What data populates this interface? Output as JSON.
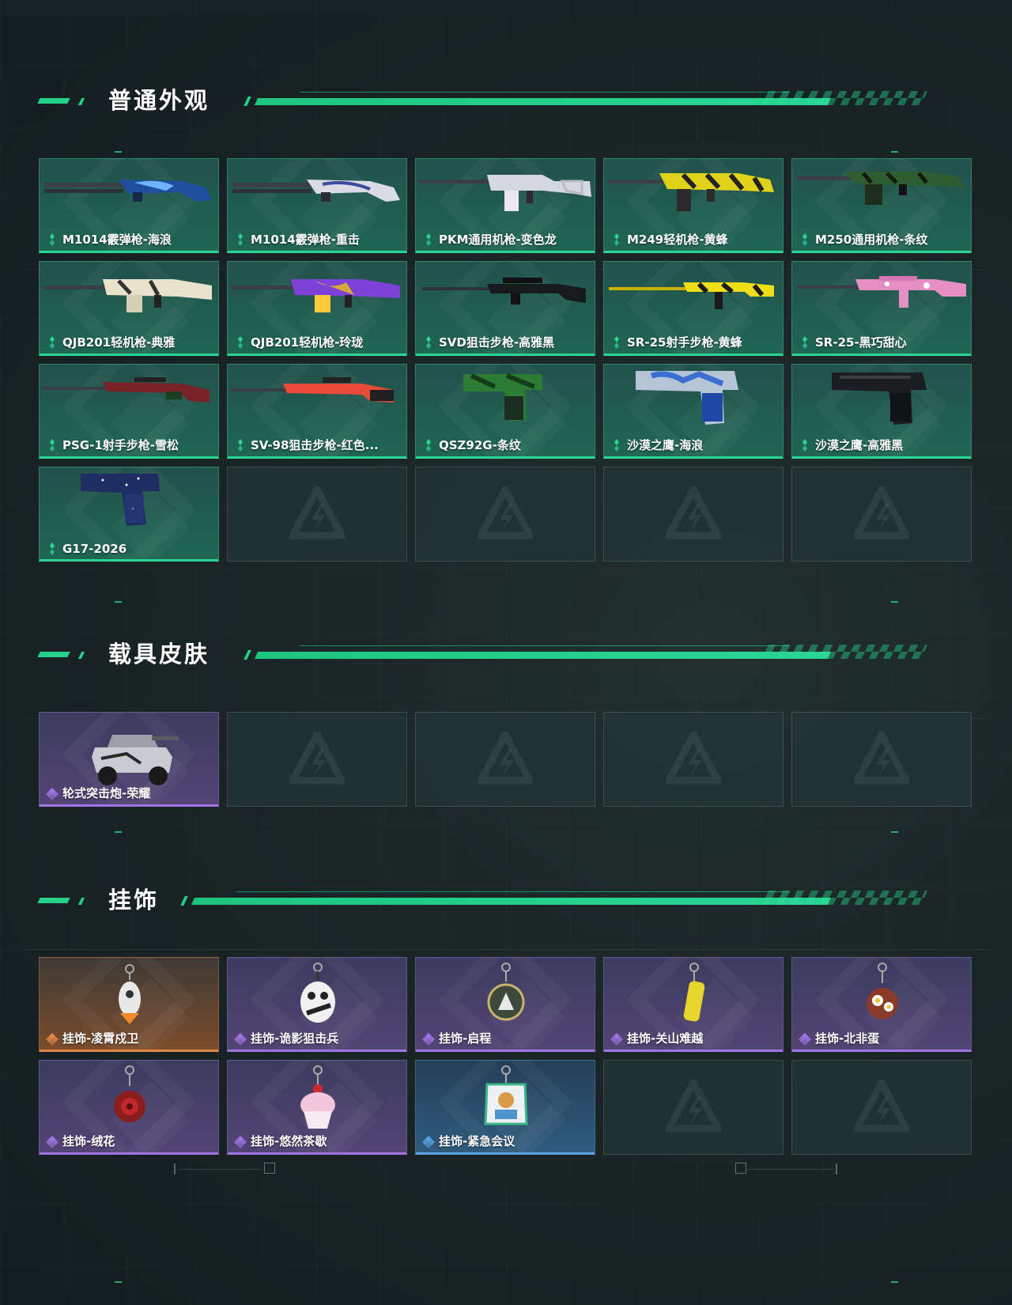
{
  "sections": [
    {
      "title": "普通外观",
      "items": [
        {
          "name": "M1014霰弹枪-海浪",
          "rarity": "green",
          "art": "shotgun-blue"
        },
        {
          "name": "M1014霰弹枪-重击",
          "rarity": "green",
          "art": "shotgun-white"
        },
        {
          "name": "PKM通用机枪-变色龙",
          "rarity": "green",
          "art": "mg-white"
        },
        {
          "name": "M249轻机枪-黄蜂",
          "rarity": "green",
          "art": "mg-yellow"
        },
        {
          "name": "M250通用机枪-条纹",
          "rarity": "green",
          "art": "mg-green"
        },
        {
          "name": "QJB201轻机枪-典雅",
          "rarity": "green",
          "art": "mg-cream"
        },
        {
          "name": "QJB201轻机枪-玲珑",
          "rarity": "green",
          "art": "mg-purple"
        },
        {
          "name": "SVD狙击步枪-高雅黑",
          "rarity": "green",
          "art": "sniper-black"
        },
        {
          "name": "SR-25射手步枪-黄蜂",
          "rarity": "green",
          "art": "rifle-yellow"
        },
        {
          "name": "SR-25-黑巧甜心",
          "rarity": "green",
          "art": "rifle-pink"
        },
        {
          "name": "PSG-1射手步枪-雪松",
          "rarity": "green",
          "art": "sniper-red"
        },
        {
          "name": "SV-98狙击步枪-红色...",
          "rarity": "green",
          "art": "sniper-orange"
        },
        {
          "name": "QSZ92G-条纹",
          "rarity": "green",
          "art": "pistol-green"
        },
        {
          "name": "沙漠之鹰-海浪",
          "rarity": "green",
          "art": "deagle-blue"
        },
        {
          "name": "沙漠之鹰-高雅黑",
          "rarity": "green",
          "art": "deagle-black"
        },
        {
          "name": "G17-2026",
          "rarity": "green",
          "art": "pistol-navy"
        }
      ],
      "empty_slots": 4
    },
    {
      "title": "载具皮肤",
      "items": [
        {
          "name": "轮式突击炮-荣耀",
          "rarity": "purple",
          "art": "vehicle"
        }
      ],
      "empty_slots": 4
    },
    {
      "title": "挂饰",
      "items": [
        {
          "name": "挂饰-凌霄戍卫",
          "rarity": "orange",
          "art": "charm-rocket"
        },
        {
          "name": "挂饰-诡影狙击兵",
          "rarity": "purple",
          "art": "charm-duck"
        },
        {
          "name": "挂饰-启程",
          "rarity": "purple",
          "art": "charm-medal"
        },
        {
          "name": "挂饰-关山难越",
          "rarity": "purple",
          "art": "charm-cylinder"
        },
        {
          "name": "挂饰-北非蛋",
          "rarity": "purple",
          "art": "charm-egg"
        },
        {
          "name": "挂饰-绒花",
          "rarity": "purple",
          "art": "charm-flower"
        },
        {
          "name": "挂饰-悠然茶歇",
          "rarity": "purple",
          "art": "charm-cupcake"
        },
        {
          "name": "挂饰-紧急会议",
          "rarity": "blue",
          "art": "charm-badge"
        }
      ],
      "empty_slots": 2
    }
  ],
  "colors": {
    "accent": "#25d08a",
    "rarity_green": "#2bd694",
    "rarity_purple": "#a174e3",
    "rarity_orange": "#e08848",
    "rarity_blue": "#5aa3e4"
  }
}
